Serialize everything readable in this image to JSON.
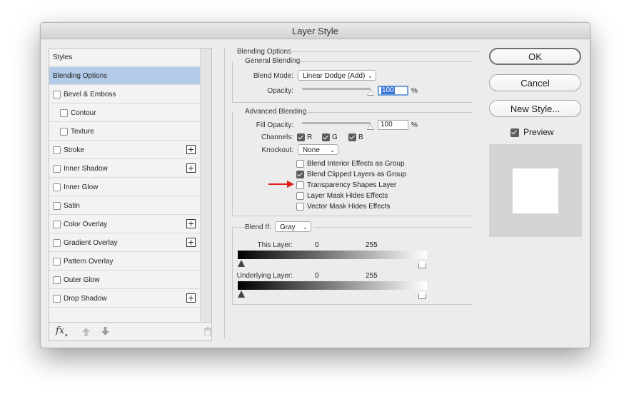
{
  "window": {
    "title": "Layer Style"
  },
  "styles_panel": {
    "header": "Styles",
    "items": [
      {
        "label": "Blending Options",
        "selected": true,
        "checkbox": false,
        "indent": false,
        "plus": false
      },
      {
        "label": "Bevel & Emboss",
        "checkbox": true,
        "checked": false,
        "indent": false,
        "plus": false
      },
      {
        "label": "Contour",
        "checkbox": true,
        "checked": false,
        "indent": true,
        "plus": false
      },
      {
        "label": "Texture",
        "checkbox": true,
        "checked": false,
        "indent": true,
        "plus": false
      },
      {
        "label": "Stroke",
        "checkbox": true,
        "checked": false,
        "indent": false,
        "plus": true
      },
      {
        "label": "Inner Shadow",
        "checkbox": true,
        "checked": false,
        "indent": false,
        "plus": true
      },
      {
        "label": "Inner Glow",
        "checkbox": true,
        "checked": false,
        "indent": false,
        "plus": false
      },
      {
        "label": "Satin",
        "checkbox": true,
        "checked": false,
        "indent": false,
        "plus": false
      },
      {
        "label": "Color Overlay",
        "checkbox": true,
        "checked": false,
        "indent": false,
        "plus": true
      },
      {
        "label": "Gradient Overlay",
        "checkbox": true,
        "checked": false,
        "indent": false,
        "plus": true
      },
      {
        "label": "Pattern Overlay",
        "checkbox": true,
        "checked": false,
        "indent": false,
        "plus": false
      },
      {
        "label": "Outer Glow",
        "checkbox": true,
        "checked": false,
        "indent": false,
        "plus": false
      },
      {
        "label": "Drop Shadow",
        "checkbox": true,
        "checked": false,
        "indent": false,
        "plus": true
      }
    ],
    "footer": {
      "fx_label": "fx"
    }
  },
  "blending": {
    "section_title": "Blending Options",
    "general": {
      "title": "General Blending",
      "blend_mode_label": "Blend Mode:",
      "blend_mode_value": "Linear Dodge (Add)",
      "opacity_label": "Opacity:",
      "opacity_value": "100",
      "opacity_unit": "%",
      "opacity_level": 1.0
    },
    "advanced": {
      "title": "Advanced Blending",
      "fill_opacity_label": "Fill Opacity:",
      "fill_opacity_value": "100",
      "fill_opacity_unit": "%",
      "fill_opacity_level": 1.0,
      "channels_label": "Channels:",
      "channels": [
        {
          "label": "R",
          "checked": true
        },
        {
          "label": "G",
          "checked": true
        },
        {
          "label": "B",
          "checked": true
        }
      ],
      "knockout_label": "Knockout:",
      "knockout_value": "None",
      "options": [
        {
          "label": "Blend Interior Effects as Group",
          "checked": false
        },
        {
          "label": "Blend Clipped Layers as Group",
          "checked": true
        },
        {
          "label": "Transparency Shapes Layer",
          "checked": false
        },
        {
          "label": "Layer Mask Hides Effects",
          "checked": false
        },
        {
          "label": "Vector Mask Hides Effects",
          "checked": false
        }
      ]
    },
    "blend_if": {
      "label": "Blend If:",
      "value": "Gray",
      "this_layer_label": "This Layer:",
      "this_layer_min": "0",
      "this_layer_max": "255",
      "underlying_label": "Underlying Layer:",
      "underlying_min": "0",
      "underlying_max": "255"
    }
  },
  "buttons": {
    "ok": "OK",
    "cancel": "Cancel",
    "new_style": "New Style..."
  },
  "preview": {
    "label": "Preview",
    "checked": true
  },
  "annotation": {
    "arrow_color": "#e02020"
  }
}
